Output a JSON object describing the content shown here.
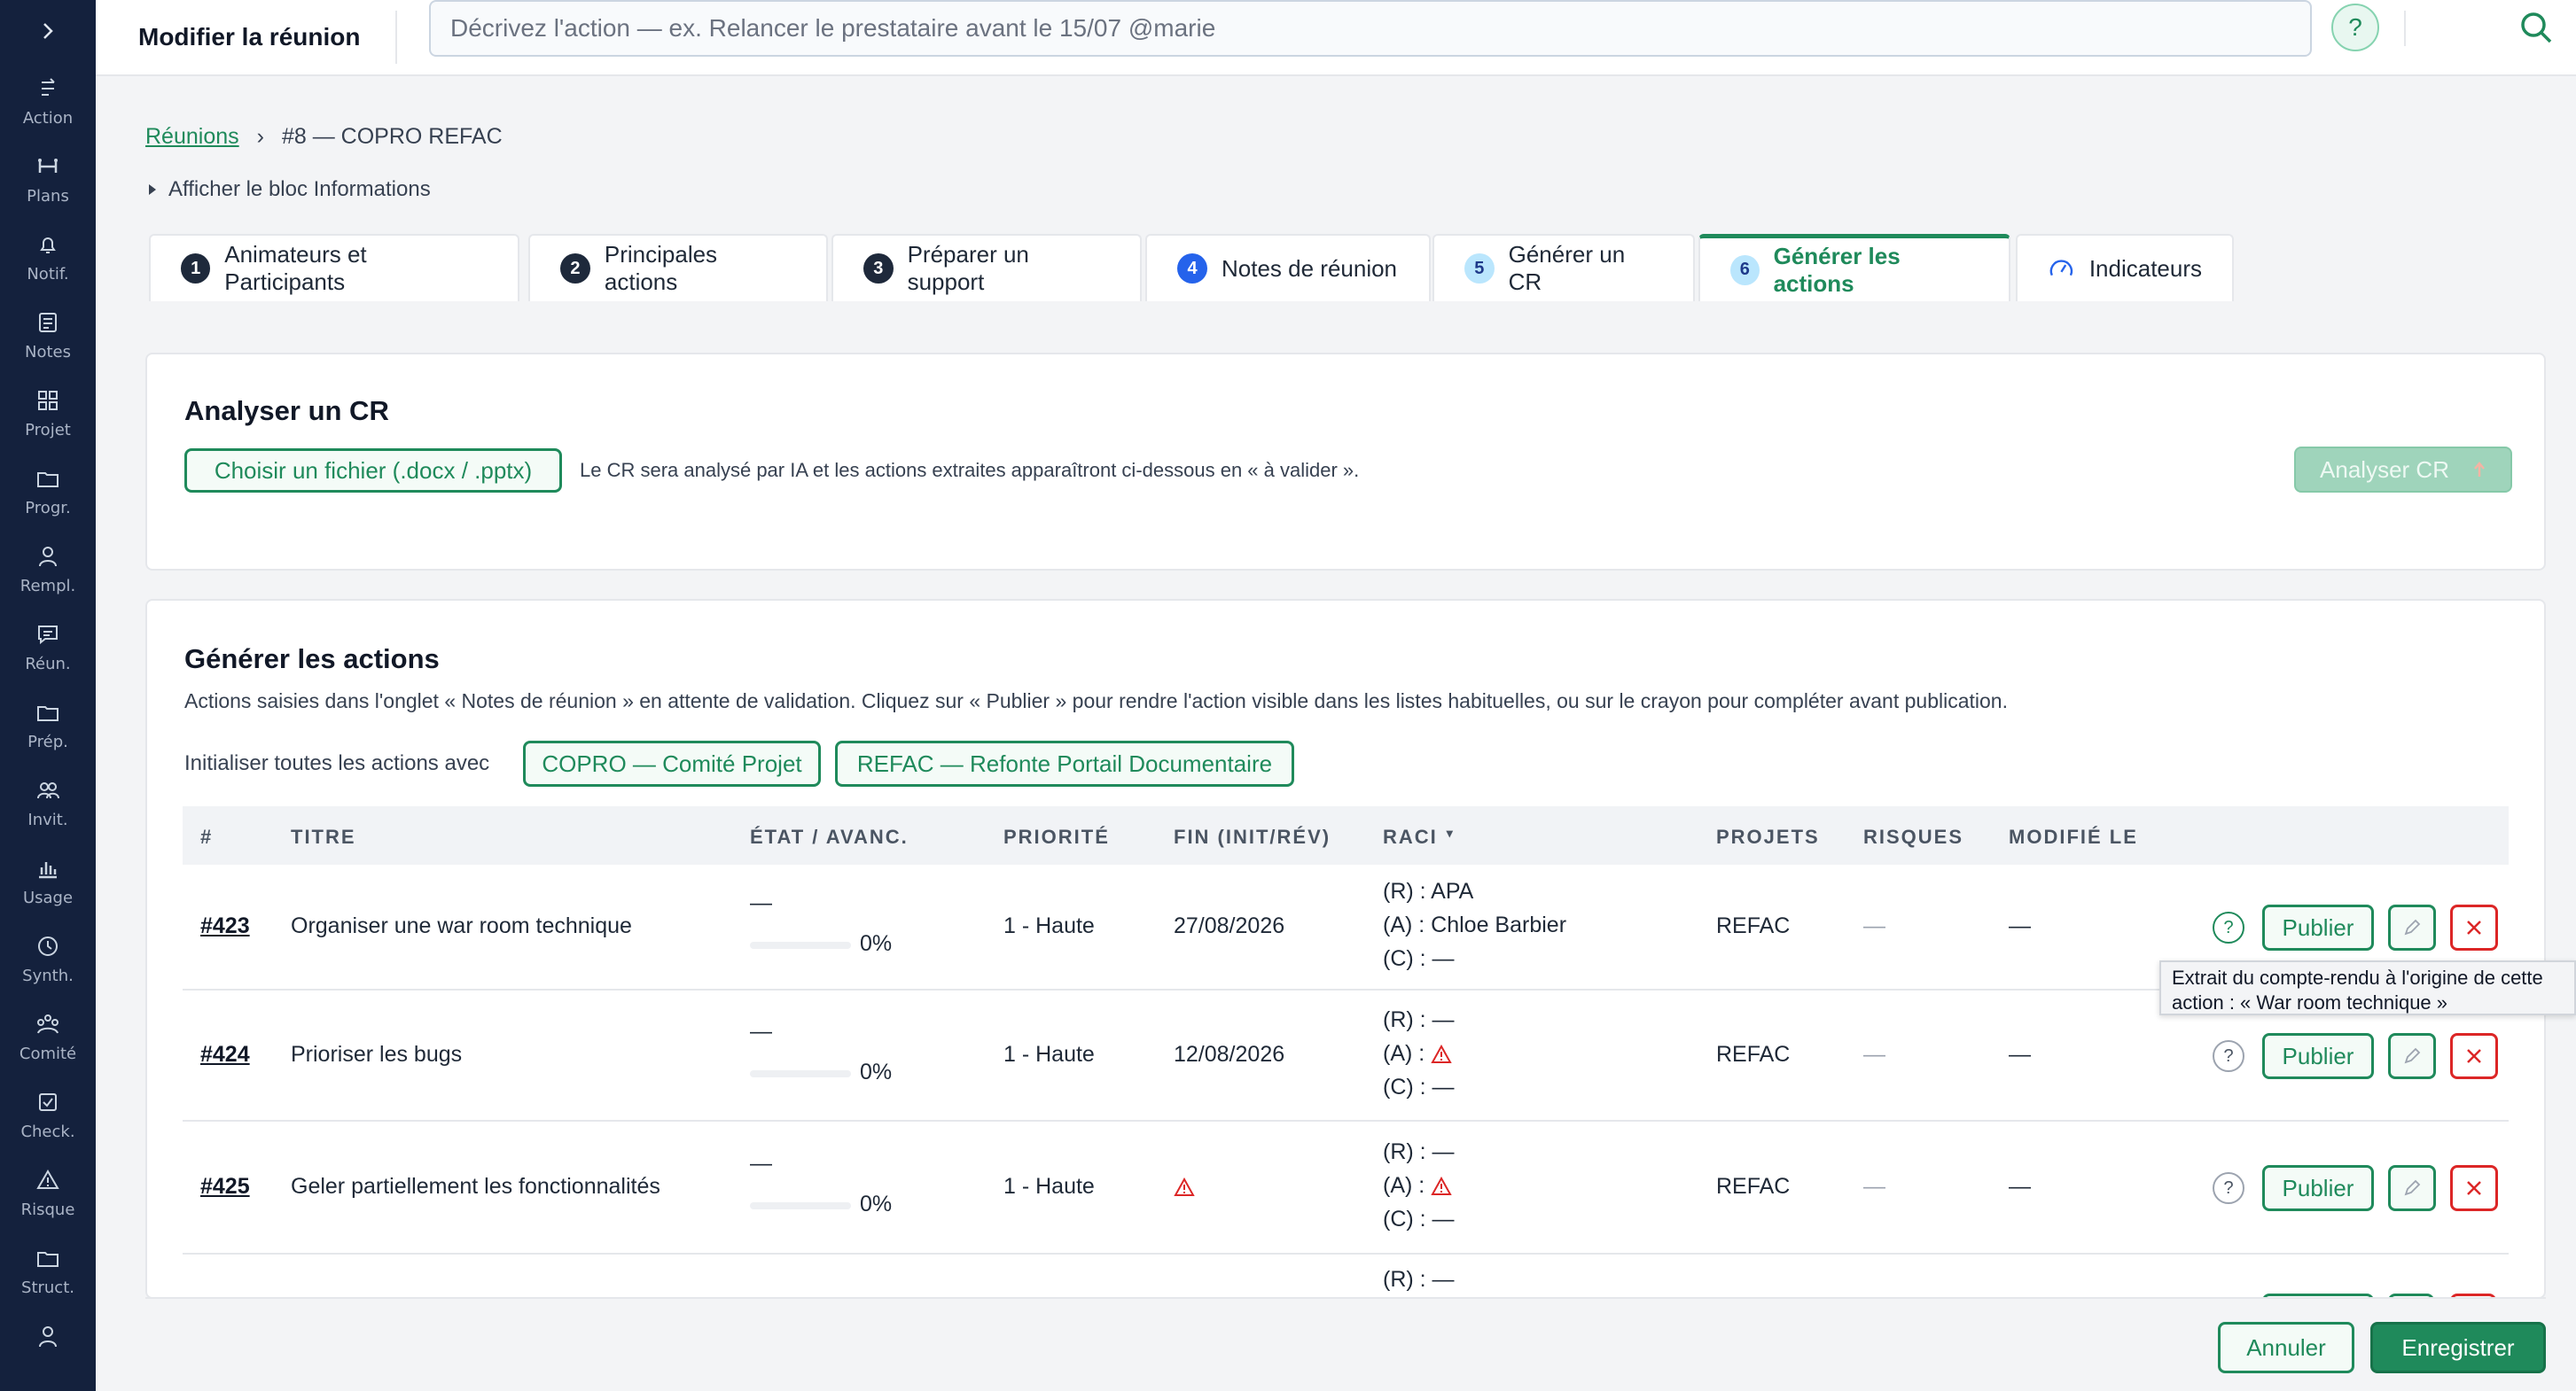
{
  "sidebar": {
    "items": [
      {
        "label": "Action",
        "icon": "action-icon"
      },
      {
        "label": "Plans",
        "icon": "plans-icon"
      },
      {
        "label": "Notif.",
        "icon": "bell-icon"
      },
      {
        "label": "Notes",
        "icon": "notes-icon"
      },
      {
        "label": "Projet",
        "icon": "grid-icon"
      },
      {
        "label": "Progr.",
        "icon": "folder-icon"
      },
      {
        "label": "Rempl.",
        "icon": "person-icon"
      },
      {
        "label": "Réun.",
        "icon": "chat-icon"
      },
      {
        "label": "Prép.",
        "icon": "folder-icon"
      },
      {
        "label": "Invit.",
        "icon": "people-icon"
      },
      {
        "label": "Usage",
        "icon": "bar-chart-icon"
      },
      {
        "label": "Synth.",
        "icon": "clock-icon"
      },
      {
        "label": "Comité",
        "icon": "group-icon"
      },
      {
        "label": "Check.",
        "icon": "checkbox-icon"
      },
      {
        "label": "Risque",
        "icon": "warning-icon"
      },
      {
        "label": "Struct.",
        "icon": "folder-icon"
      }
    ]
  },
  "header": {
    "title": "Modifier la réunion",
    "command_placeholder": "Décrivez l'action — ex. Relancer le prestataire avant le 15/07 @marie",
    "help": "?"
  },
  "breadcrumb": {
    "parent": "Réunions",
    "separator": "›",
    "current": "#8 — COPRO REFAC"
  },
  "info_toggle": "Afficher le bloc Informations",
  "tabs": [
    {
      "num": "1",
      "label": "Animateurs et Participants"
    },
    {
      "num": "2",
      "label": "Principales actions"
    },
    {
      "num": "3",
      "label": "Préparer un support"
    },
    {
      "num": "4",
      "label": "Notes de réunion"
    },
    {
      "num": "5",
      "label": "Générer un CR"
    },
    {
      "num": "6",
      "label": "Générer les actions"
    },
    {
      "num": "",
      "label": "Indicateurs"
    }
  ],
  "analyser": {
    "title": "Analyser un CR",
    "file_button": "Choisir un fichier (.docx / .pptx)",
    "hint": "Le CR sera analysé par IA et les actions extraites apparaîtront ci-dessous en « à valider ».",
    "submit": "Analyser CR"
  },
  "generer": {
    "title": "Générer les actions",
    "description": "Actions saisies dans l'onglet « Notes de réunion » en attente de validation. Cliquez sur « Publier » pour rendre l'action visible dans les listes habituelles, ou sur le crayon pour compléter avant publication.",
    "init_label": "Initialiser toutes les actions avec",
    "init_options": [
      "COPRO — Comité Projet",
      "REFAC — Refonte Portail Documentaire"
    ]
  },
  "table": {
    "headers": {
      "num": "#",
      "titre": "TITRE",
      "etat": "ÉTAT / AVANC.",
      "priorite": "PRIORITÉ",
      "fin": "FIN (INIT/RÉV)",
      "raci": "RACI",
      "raci_sort": "▾",
      "projets": "PROJETS",
      "risques": "RISQUES",
      "modifie": "MODIFIÉ LE"
    },
    "rows": [
      {
        "id": "#423",
        "titre": "Organiser une war room technique",
        "etat": "—",
        "progress_text": "0%",
        "progress": 0,
        "priorite": "1 - Haute",
        "fin": "27/08/2026",
        "fin_warning": false,
        "raci_r": "(R) : APA",
        "raci_a": "(A) : Chloe Barbier",
        "raci_a_warning": false,
        "raci_c": "(C) : —",
        "projets": "REFAC",
        "risques": "—",
        "modifie": "—",
        "publish": "Publier"
      },
      {
        "id": "#424",
        "titre": "Prioriser les bugs",
        "etat": "—",
        "progress_text": "0%",
        "progress": 0,
        "priorite": "1 - Haute",
        "fin": "12/08/2026",
        "fin_warning": false,
        "raci_r": "(R) : —",
        "raci_a": "(A) :",
        "raci_a_warning": true,
        "raci_c": "(C) : —",
        "projets": "REFAC",
        "risques": "—",
        "modifie": "—",
        "publish": "Publier"
      },
      {
        "id": "#425",
        "titre": "Geler partiellement les fonctionnalités",
        "etat": "—",
        "progress_text": "0%",
        "progress": 0,
        "priorite": "1 - Haute",
        "fin": "",
        "fin_warning": true,
        "raci_r": "(R) : —",
        "raci_a": "(A) :",
        "raci_a_warning": true,
        "raci_c": "(C) : —",
        "projets": "REFAC",
        "risques": "—",
        "modifie": "—",
        "publish": "Publier"
      }
    ],
    "partial_row_raci_r": "(R) : —"
  },
  "tooltip": {
    "line1": "Extrait du compte-rendu à l'origine de cette",
    "line2": "action : « War room technique »"
  },
  "footer": {
    "cancel": "Annuler",
    "save": "Enregistrer"
  },
  "colors": {
    "sidebar": "#14213d",
    "accent": "#1f8a5b",
    "danger": "#dc2626"
  }
}
